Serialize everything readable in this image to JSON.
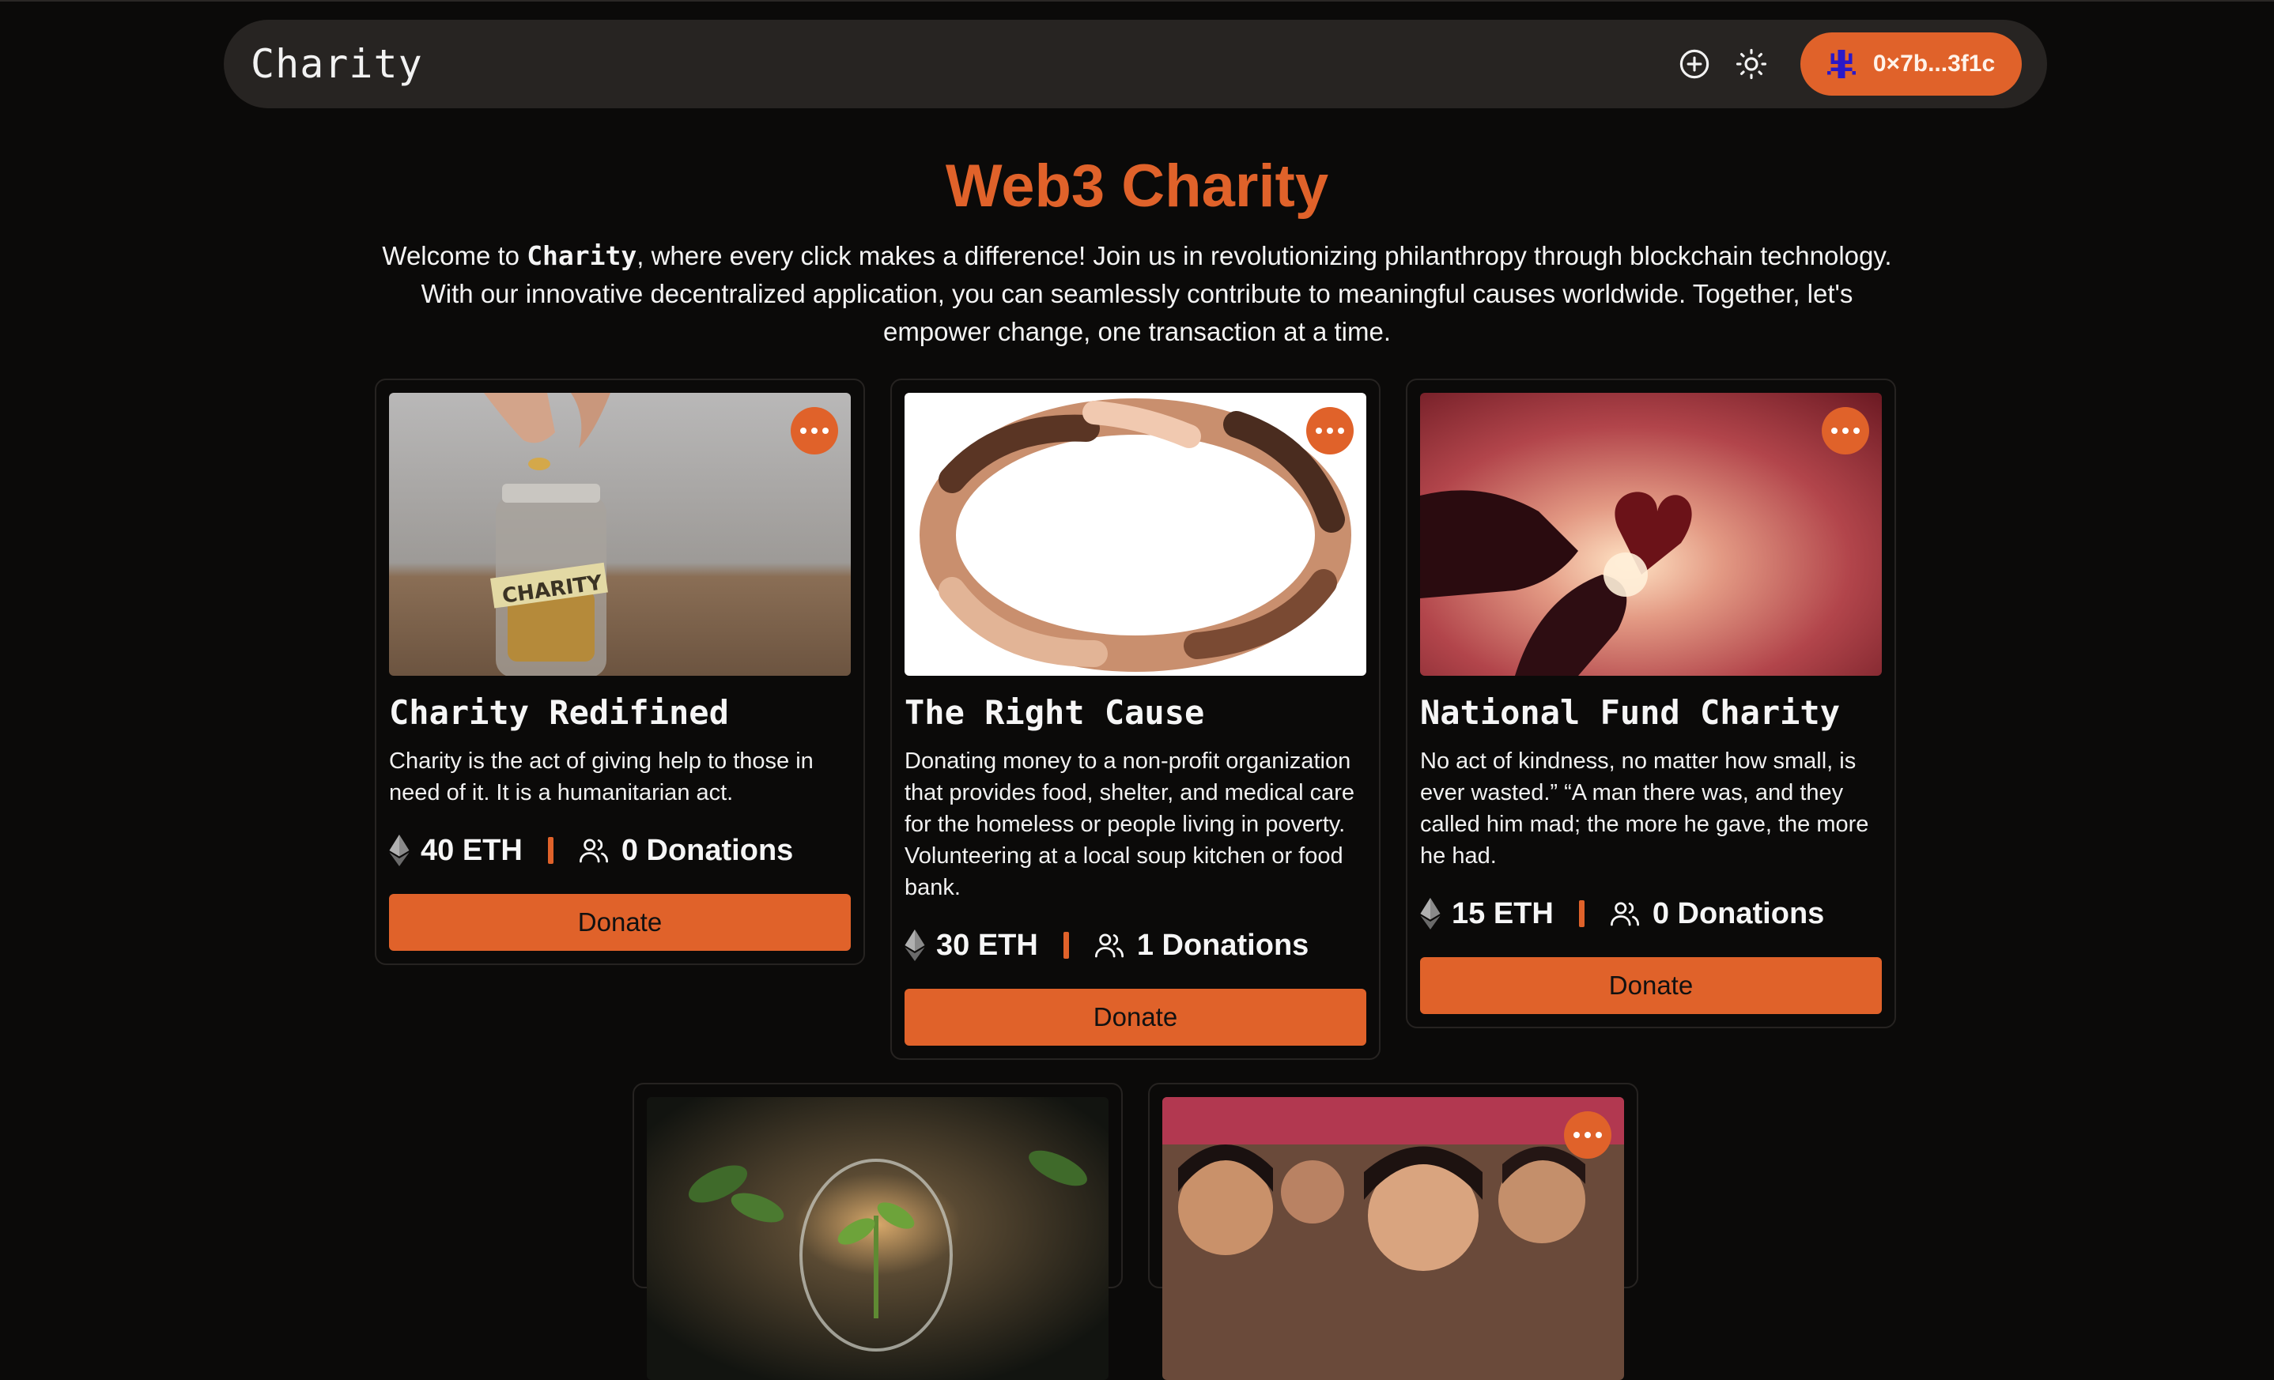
{
  "navbar": {
    "brand": "Charity",
    "create_icon": "plus-circle-icon",
    "theme_icon": "sun-icon",
    "wallet_label": "0×7b...3f1c"
  },
  "hero": {
    "title": "Web3 Charity",
    "intro_before": "Welcome to ",
    "intro_brand": "Charity",
    "intro_after": ", where every click makes a difference! Join us in revolutionizing philanthropy through blockchain technology. With our innovative decentralized application, you can seamlessly contribute to meaningful causes worldwide. Together, let's empower change, one transaction at a time."
  },
  "cards": [
    {
      "title": "Charity Redifined",
      "description": "Charity is the act of giving help to those in need of it. It is a humanitarian act.",
      "amount": "40 ETH",
      "donations": "0 Donations",
      "donate_label": "Donate"
    },
    {
      "title": "The Right Cause",
      "description": "Donating money to a non-profit organization that provides food, shelter, and medical care for the homeless or people living in poverty. Volunteering at a local soup kitchen or food bank.",
      "amount": "30 ETH",
      "donations": "1 Donations",
      "donate_label": "Donate"
    },
    {
      "title": "National Fund Charity",
      "description": "No act of kindness, no matter how small, is ever wasted.” “A man there was, and they called him mad; the more he gave, the more he had.",
      "amount": "15 ETH",
      "donations": "0 Donations",
      "donate_label": "Donate"
    }
  ],
  "colors": {
    "accent": "#e0622a",
    "background": "#0b0a09",
    "navbar": "#272422"
  }
}
